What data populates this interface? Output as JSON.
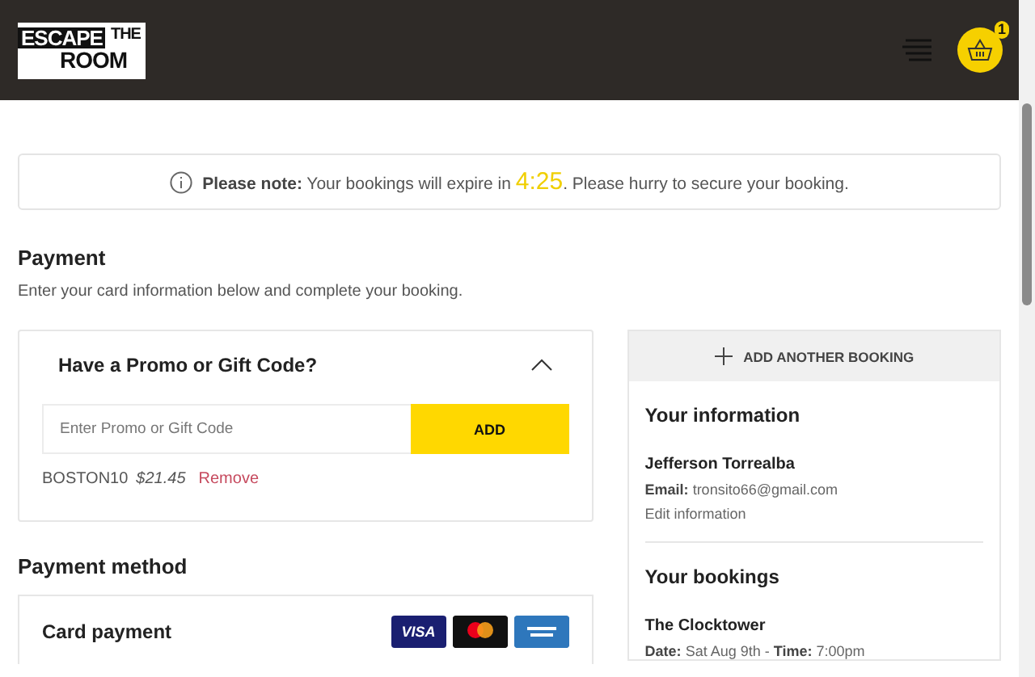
{
  "header": {
    "logo": {
      "words": [
        "ESCAPE",
        "THE",
        "ROOM"
      ]
    },
    "cart_count": "1"
  },
  "notice": {
    "text": "**Please note:** Your bookings will expire in",
    "timer": "4:25",
    "after": ". Please hurry to secure your booking."
  },
  "payment": {
    "title": "Payment",
    "subtitle": "Enter your card information below and complete your booking."
  },
  "promo": {
    "title": "Have a Promo or Gift Code?",
    "expanded": true,
    "placeholder": "Enter Promo or Gift Code",
    "button": "ADD",
    "applied_code": "BOSTON10",
    "applied_amount": "$21.45",
    "remove": "Remove"
  },
  "payment_method": {
    "title": "Payment method",
    "card_title": "Card payment",
    "cards": [
      {
        "kind": "visa",
        "label": "VISA"
      },
      {
        "kind": "mastercard"
      },
      {
        "kind": "amex"
      }
    ]
  },
  "sidebar": {
    "add_booking": "ADD ANOTHER BOOKING",
    "info_title": "Your information",
    "name": "Jefferson Torrealba",
    "email_label": "Email:",
    "email": "tronsito66@gmail.com",
    "edit": "Edit information",
    "bookings_title": "Your bookings",
    "bookings": [
      {
        "name": "The Clocktower",
        "date_label": "Date:",
        "date": "Sat Aug 9th",
        "separator": "-",
        "time_label": "Time:",
        "time": "7:00pm"
      }
    ]
  }
}
